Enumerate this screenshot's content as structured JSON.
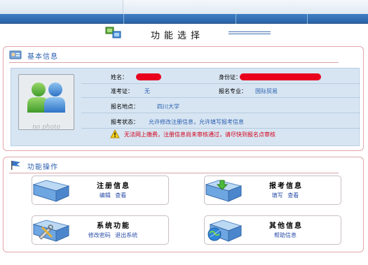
{
  "page": {
    "title": "功能选择"
  },
  "basic_info": {
    "section_title": "基本信息",
    "photo_caption": "no photo",
    "fields": {
      "name_label": "姓名：",
      "id_label": "身份证：",
      "exam_no_label": "准考证：",
      "exam_no_value": "无",
      "major_label": "报名专业：",
      "major_value": "国际贸易",
      "location_label": "报名地点：",
      "location_value": "四川大学",
      "status_label": "报考状态：",
      "status_value": "允许修改注册信息，允许填写报考信息"
    },
    "warning": "无法网上缴费，注册信息尚未审核通过，请尽快到报名点审核"
  },
  "functions": {
    "section_title": "功能操作",
    "cards": [
      {
        "name": "注册信息",
        "links": [
          "编辑",
          "查看"
        ],
        "icon": "folder-icon"
      },
      {
        "name": "报考信息",
        "links": [
          "填写",
          "查看"
        ],
        "icon": "folder-download-icon"
      },
      {
        "name": "系统功能",
        "links": [
          "修改密码",
          "退出系统"
        ],
        "icon": "folder-tools-icon"
      },
      {
        "name": "其他信息",
        "links": [
          "帮助信息"
        ],
        "icon": "globe-folder-icon"
      }
    ]
  },
  "colors": {
    "accent_blue": "#2a5fb0",
    "panel_border": "#e3a6ab",
    "warning_red": "#d4001a",
    "info_bg": "#d7e5f2"
  }
}
